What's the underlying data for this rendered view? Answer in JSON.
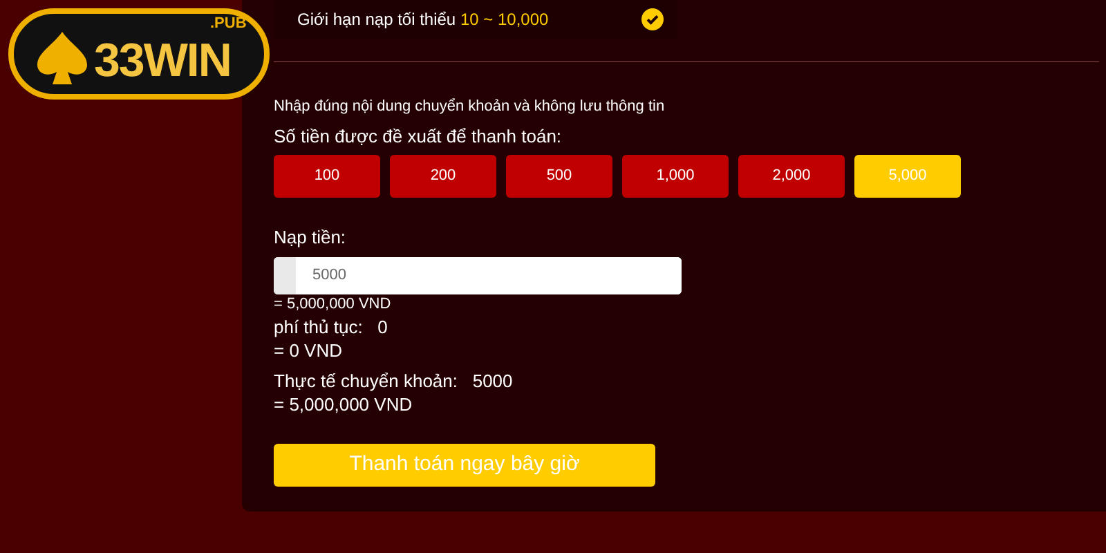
{
  "logo": {
    "name": "33WIN",
    "suffix": ".PUB"
  },
  "limit": {
    "label": "Giới hạn nạp tối thiểu",
    "range": "10 ~ 10,000",
    "checked": true
  },
  "notice": "Nhập đúng nội dung chuyển khoản và không lưu thông tin",
  "suggest_label": "Số tiền được đề xuất để thanh toán:",
  "amounts": [
    {
      "label": "100",
      "selected": false
    },
    {
      "label": "200",
      "selected": false
    },
    {
      "label": "500",
      "selected": false
    },
    {
      "label": "1,000",
      "selected": false
    },
    {
      "label": "2,000",
      "selected": false
    },
    {
      "label": "5,000",
      "selected": true
    }
  ],
  "deposit": {
    "label": "Nạp tiền:",
    "value": "5000",
    "converted": "= 5,000,000 VND"
  },
  "fee": {
    "label": "phí thủ tục:",
    "value": "0",
    "converted": "= 0 VND"
  },
  "actual": {
    "label": "Thực tế chuyển khoản:",
    "value": "5000",
    "converted": "= 5,000,000 VND"
  },
  "pay_button": "Thanh toán ngay bây giờ"
}
